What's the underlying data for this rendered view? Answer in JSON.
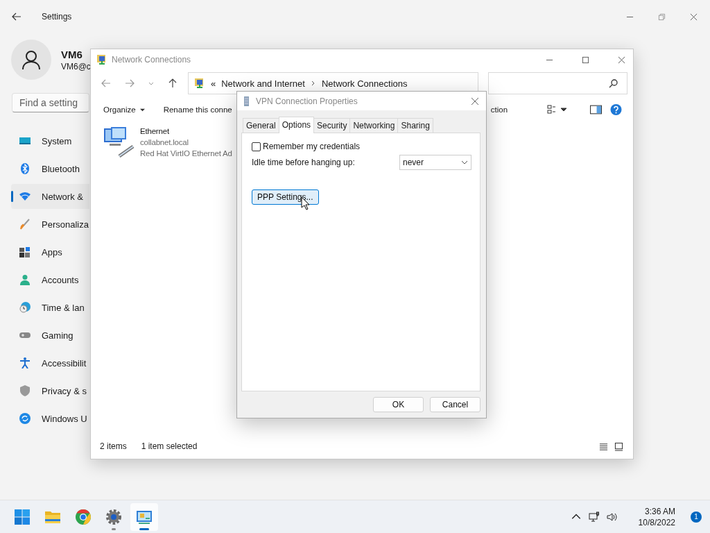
{
  "settings": {
    "title": "Settings",
    "user": {
      "name": "VM6",
      "email": "VM6@c"
    },
    "search": {
      "placeholder": "Find a setting"
    },
    "nav": [
      {
        "label": "System",
        "selected": false
      },
      {
        "label": "Bluetooth",
        "selected": false
      },
      {
        "label": "Network &",
        "selected": true
      },
      {
        "label": "Personaliza",
        "selected": false
      },
      {
        "label": "Apps",
        "selected": false
      },
      {
        "label": "Accounts",
        "selected": false
      },
      {
        "label": "Time & lan",
        "selected": false
      },
      {
        "label": "Gaming",
        "selected": false
      },
      {
        "label": "Accessibilit",
        "selected": false
      },
      {
        "label": "Privacy & s",
        "selected": false
      },
      {
        "label": "Windows U",
        "selected": false
      }
    ]
  },
  "explorer": {
    "title": "Network Connections",
    "address": {
      "prefix": "«",
      "parts": [
        "Network and Internet",
        "Network Connections"
      ]
    },
    "toolbar": [
      {
        "label": "Organize",
        "dropdown": true
      },
      {
        "label": "Rename this conne",
        "dropdown": false
      },
      {
        "label": "ction",
        "dropdown": false
      }
    ],
    "items": [
      {
        "name": "Ethernet",
        "lines": [
          "collabnet.local",
          "Red Hat VirtIO Ethernet Ad"
        ]
      }
    ],
    "status": [
      "2 items",
      "1 item selected"
    ]
  },
  "dialog": {
    "title": "VPN Connection Properties",
    "tabs": [
      {
        "label": "General",
        "selected": false
      },
      {
        "label": "Options",
        "selected": true
      },
      {
        "label": "Security",
        "selected": false
      },
      {
        "label": "Networking",
        "selected": false
      },
      {
        "label": "Sharing",
        "selected": false
      }
    ],
    "remember": {
      "label": "Remember my credentials",
      "checked": false
    },
    "idle": {
      "label": "Idle time before hanging up:",
      "value": "never"
    },
    "ppp_button": {
      "label": "PPP Settings...",
      "hovered": true
    },
    "buttons": [
      {
        "label": "OK",
        "hovered": false
      },
      {
        "label": "Cancel",
        "hovered": false
      }
    ]
  },
  "taskbar": {
    "apps": [
      {
        "running": false,
        "active": false
      },
      {
        "running": false,
        "active": false
      },
      {
        "running": false,
        "active": false
      },
      {
        "running": true,
        "active": false
      },
      {
        "running": true,
        "active": true
      }
    ],
    "time": "3:36 AM",
    "date": "10/8/2022",
    "notifications": "1"
  }
}
